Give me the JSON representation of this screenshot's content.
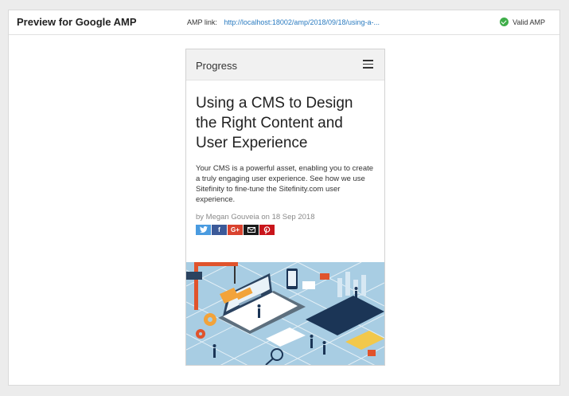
{
  "topbar": {
    "title": "Preview for Google AMP",
    "amp_link_label": "AMP link:",
    "amp_link_url": "http://localhost:18002/amp/2018/09/18/using-a-...",
    "valid_label": "Valid AMP"
  },
  "phone": {
    "brand": "Progress",
    "headline": "Using a CMS to Design the Right Content and User Experience",
    "excerpt": "Your CMS is a powerful asset, enabling you to create a truly engaging user experience. See how we use Sitefinity to fine-tune the Sitefinity.com user experience.",
    "byline": "by Megan Gouveia on 18 Sep 2018",
    "share": {
      "twitter_icon": "twitter-icon",
      "facebook_label": "f",
      "googleplus_label": "G+",
      "email_icon": "mail-icon",
      "pinterest_icon": "pinterest-icon"
    }
  },
  "colors": {
    "link": "#2a7bc0",
    "valid_green": "#3fae49",
    "hero_bg": "#a8cde3"
  }
}
